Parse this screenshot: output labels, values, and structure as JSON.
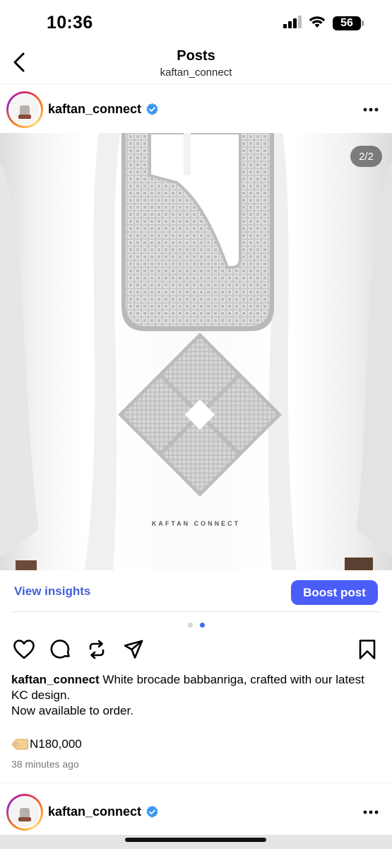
{
  "status_bar": {
    "time": "10:36",
    "battery": "56"
  },
  "header": {
    "title": "Posts",
    "subtitle": "kaftan_connect"
  },
  "post": {
    "username": "kaftan_connect",
    "image_counter": "2/2",
    "brand_watermark": "KAFTAN CONNECT",
    "current_slide": 2,
    "total_slides": 2,
    "view_insights_label": "View insights",
    "boost_label": "Boost post",
    "caption_user": "kaftan_connect",
    "caption_text": " White brocade babbanriga, crafted with our latest KC design.",
    "caption_line2": "Now available to order.",
    "price": "N180,000",
    "timestamp": "38 minutes ago"
  },
  "next_post": {
    "username": "kaftan_connect"
  },
  "colors": {
    "accent": "#4a5df9",
    "link": "#4262d9",
    "verified": "#3897f0"
  },
  "icons": {
    "back": "chevron-left-icon",
    "verified": "verified-badge-icon",
    "more": "more-horizontal-icon",
    "like": "heart-icon",
    "comment": "comment-icon",
    "repost": "repost-icon",
    "share": "send-icon",
    "save": "bookmark-icon",
    "price_tag": "label-tag-icon"
  }
}
